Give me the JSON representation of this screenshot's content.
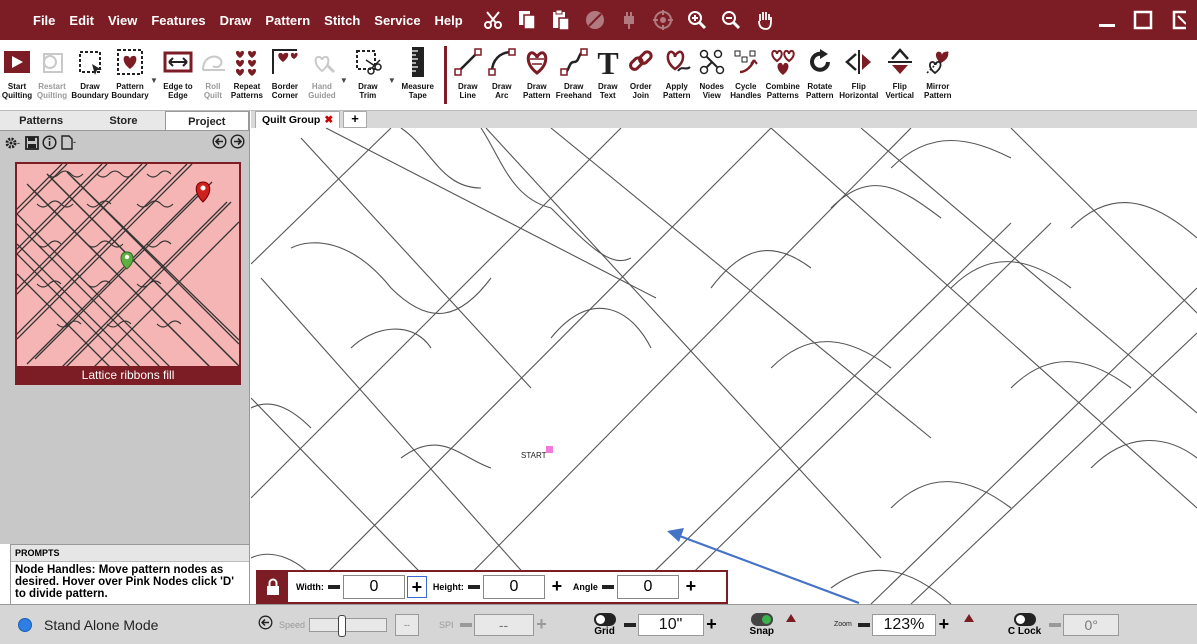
{
  "menu": [
    "File",
    "Edit",
    "View",
    "Features",
    "Draw",
    "Pattern",
    "Stitch",
    "Service",
    "Help"
  ],
  "toolbar": {
    "tools": [
      {
        "label": "Start\nQuilting",
        "icon": "play-icon",
        "disabled": false
      },
      {
        "label": "Restart\nQuilting",
        "icon": "restart-icon",
        "disabled": true
      },
      {
        "label": "Draw\nBoundary",
        "icon": "boundary-icon",
        "disabled": false
      },
      {
        "label": "Pattern\nBoundary",
        "icon": "pattern-boundary-icon",
        "disabled": false
      },
      {
        "label": "Edge to\nEdge",
        "icon": "edge-to-edge-icon",
        "disabled": false
      },
      {
        "label": "Roll\nQuilt",
        "icon": "roll-quilt-icon",
        "disabled": true
      },
      {
        "label": "Repeat\nPatterns",
        "icon": "repeat-patterns-icon",
        "disabled": false
      },
      {
        "label": "Border\nCorner",
        "icon": "border-corner-icon",
        "disabled": false
      },
      {
        "label": "Hand\nGuided",
        "icon": "hand-guided-icon",
        "disabled": true
      },
      {
        "label": "Draw\nTrim",
        "icon": "draw-trim-icon",
        "disabled": false
      },
      {
        "label": "Measure\nTape",
        "icon": "measure-tape-icon",
        "disabled": false
      },
      {
        "label": "Draw\nLine",
        "icon": "draw-line-icon",
        "disabled": false
      },
      {
        "label": "Draw\nArc",
        "icon": "draw-arc-icon",
        "disabled": false
      },
      {
        "label": "Draw\nPattern",
        "icon": "draw-pattern-icon",
        "disabled": false
      },
      {
        "label": "Draw\nFreehand",
        "icon": "draw-freehand-icon",
        "disabled": false
      },
      {
        "label": "Draw\nText",
        "icon": "draw-text-icon",
        "disabled": false
      },
      {
        "label": "Order\nJoin",
        "icon": "order-join-icon",
        "disabled": false
      },
      {
        "label": "Apply\nPattern",
        "icon": "apply-pattern-icon",
        "disabled": false
      },
      {
        "label": "Nodes\nView",
        "icon": "nodes-view-icon",
        "disabled": false
      },
      {
        "label": "Cycle\nHandles",
        "icon": "cycle-handles-icon",
        "disabled": false
      },
      {
        "label": "Combine\nPatterns",
        "icon": "combine-patterns-icon",
        "disabled": false
      },
      {
        "label": "Rotate\nPattern",
        "icon": "rotate-pattern-icon",
        "disabled": false
      },
      {
        "label": "Flip\nHorizontal",
        "icon": "flip-horizontal-icon",
        "disabled": false
      },
      {
        "label": "Flip\nVertical",
        "icon": "flip-vertical-icon",
        "disabled": false
      },
      {
        "label": "Mirror\nPattern",
        "icon": "mirror-pattern-icon",
        "disabled": false
      }
    ]
  },
  "left_panel": {
    "tabs": [
      "Patterns",
      "Store",
      "Project"
    ],
    "active_tab": "Project",
    "thumbnail_caption": "Lattice ribbons fill"
  },
  "prompts": {
    "header": "PROMPTS",
    "text": "Node Handles: Move pattern nodes as desired. Hover over Pink Nodes click 'D' to divide pattern."
  },
  "canvas": {
    "tab_label": "Quilt Group",
    "start_label": "START"
  },
  "dims": {
    "width_label": "Width:",
    "width_value": "0",
    "height_label": "Height:",
    "height_value": "0",
    "angle_label": "Angle",
    "angle_value": "0"
  },
  "statusbar": {
    "mode": "Stand Alone Mode",
    "speed_label": "Speed",
    "speed_value": "--",
    "spi_label": "SPI",
    "spi_value": "--",
    "grid_label": "Grid",
    "grid_value": "10\"",
    "snap_label": "Snap",
    "zoom_label": "Zoom",
    "zoom_value": "123%",
    "clock_label": "C Lock",
    "angle_value": "0°"
  },
  "colors": {
    "brand": "#7c1c24",
    "thumbnail_bg": "#f6b5b5",
    "arrow": "#4472c4"
  }
}
